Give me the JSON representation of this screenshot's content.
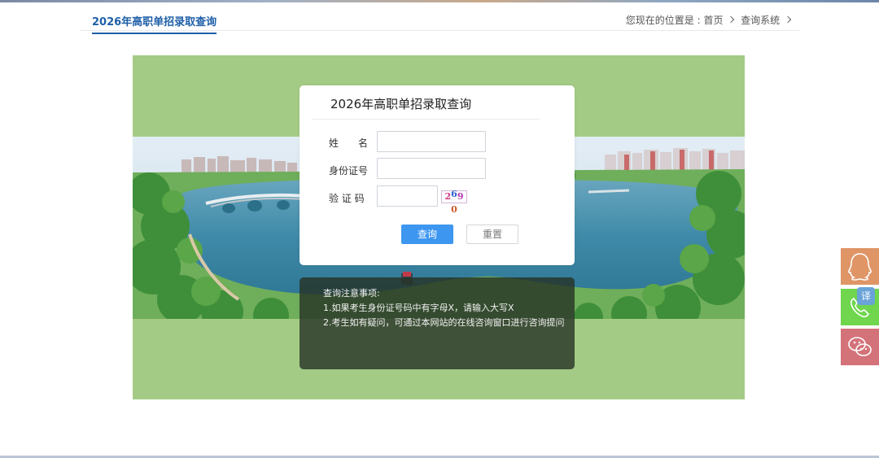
{
  "header": {
    "title": "2026年高职单招录取查询",
    "location_prefix": "您现在的位置是 :",
    "breadcrumb": [
      "首页",
      "查询系统"
    ]
  },
  "form": {
    "title": "2026年高职单招录取查询",
    "fields": [
      {
        "label": "姓　　名",
        "value": ""
      },
      {
        "label": "身份证号",
        "value": ""
      },
      {
        "label": "验 证 码",
        "value": ""
      }
    ],
    "captcha_chars": [
      "2",
      "6",
      "9",
      "0"
    ],
    "submit_label": "查询",
    "reset_label": "重置"
  },
  "notice": {
    "title": "查询注意事项:",
    "items": [
      "1.如果考生身份证号码中有字母X，请输入大写X",
      "2.考生如有疑问，可通过本网站的在线咨询窗口进行咨询提问"
    ]
  },
  "side": {
    "translate_label": "译"
  },
  "colors": {
    "accent": "#1e5fa8",
    "banner_green": "#a4cb85",
    "submit_blue": "#3d96f0",
    "qq_orange": "#df9566",
    "phone_green": "#6fd64d",
    "wechat_pink": "#d4727a"
  },
  "icons": [
    "qq-icon",
    "phone-icon",
    "wechat-icon",
    "chevron-right-icon"
  ]
}
